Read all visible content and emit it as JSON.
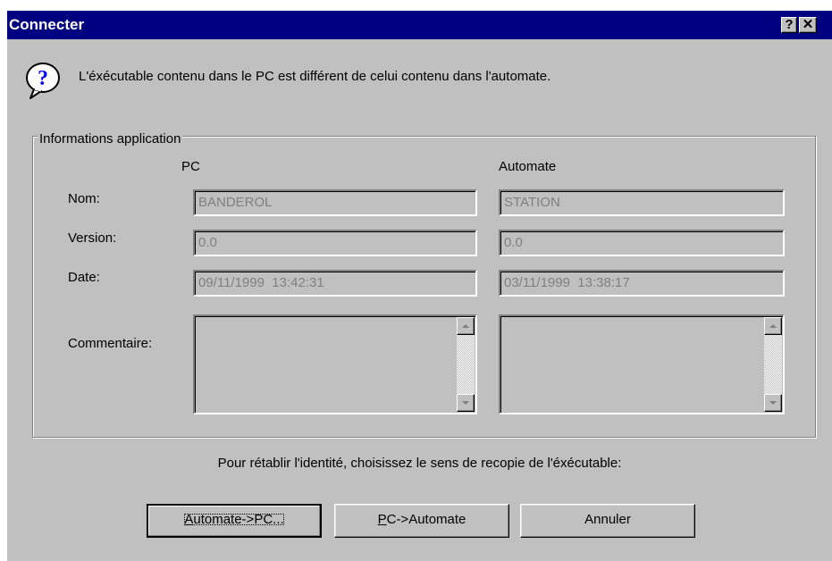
{
  "window": {
    "title": "Connecter",
    "help_label": "?",
    "close_label": "✕"
  },
  "message": "L'éxécutable contenu dans le PC est différent de celui contenu dans l'automate.",
  "group": {
    "label": "Informations application",
    "col_pc": "PC",
    "col_automate": "Automate",
    "rows": {
      "nom": {
        "label": "Nom:",
        "pc": "BANDEROL",
        "automate": "STATION"
      },
      "version": {
        "label": "Version:",
        "pc": "0.0",
        "automate": "0.0"
      },
      "date": {
        "label": "Date:",
        "pc": "09/11/1999  13:42:31",
        "automate": "03/11/1999  13:38:17"
      },
      "commentaire": {
        "label": "Commentaire:",
        "pc": "",
        "automate": ""
      }
    }
  },
  "instruction": "Pour rétablir l'identité, choisissez le sens de recopie de l'éxécutable:",
  "buttons": {
    "automate_pc": {
      "mnemonic": "A",
      "rest": "utomate->PC..."
    },
    "pc_automate": {
      "mnemonic": "P",
      "rest": "C->Automate"
    },
    "annuler": "Annuler"
  },
  "icons": {
    "question": "question-icon"
  },
  "colors": {
    "title_bar": "#000080",
    "dialog_bg": "#c0c0c0",
    "disabled_text": "#808080"
  }
}
